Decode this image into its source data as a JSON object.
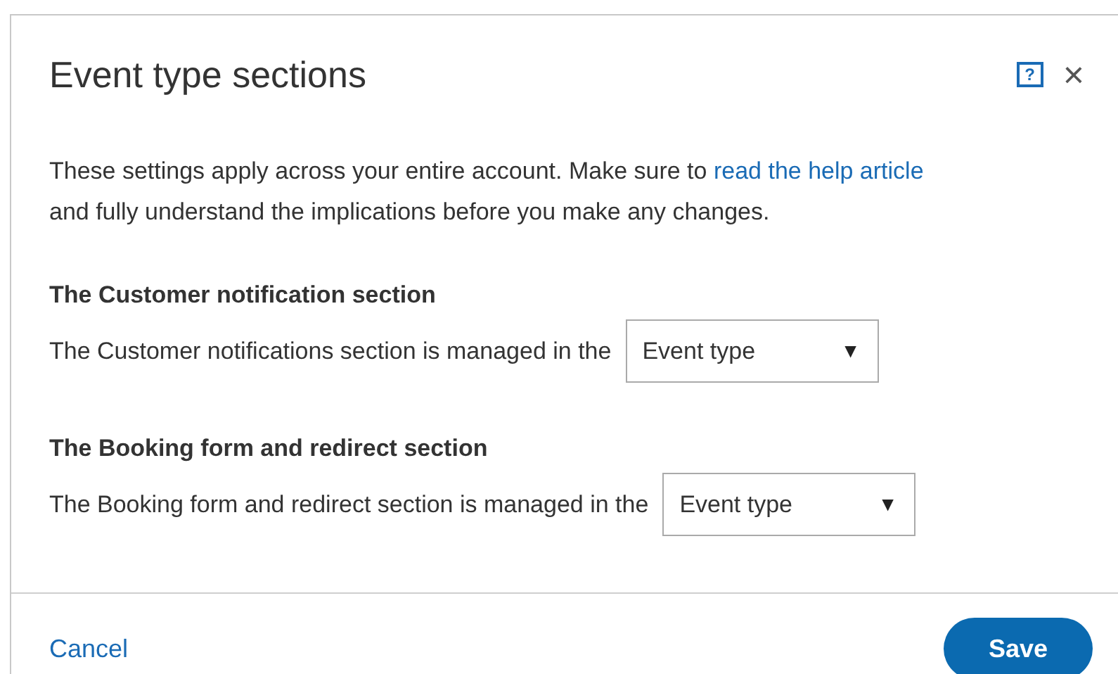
{
  "dialog": {
    "title": "Event type sections",
    "help_icon": "?",
    "close_icon": "×",
    "intro": {
      "text_before": "These settings apply across your entire account. Make sure to ",
      "link": "read the help article",
      "text_after": "and fully understand the implications before you make any changes."
    },
    "sections": [
      {
        "heading": "The Customer notification section",
        "label": "The Customer notifications section is managed in the",
        "select": {
          "value": "Event type",
          "caret": "▼"
        }
      },
      {
        "heading": "The Booking form and redirect section",
        "label": "The Booking form and redirect section is managed in the",
        "select": {
          "value": "Event type",
          "caret": "▼"
        }
      }
    ],
    "footer": {
      "cancel": "Cancel",
      "save": "Save"
    }
  }
}
